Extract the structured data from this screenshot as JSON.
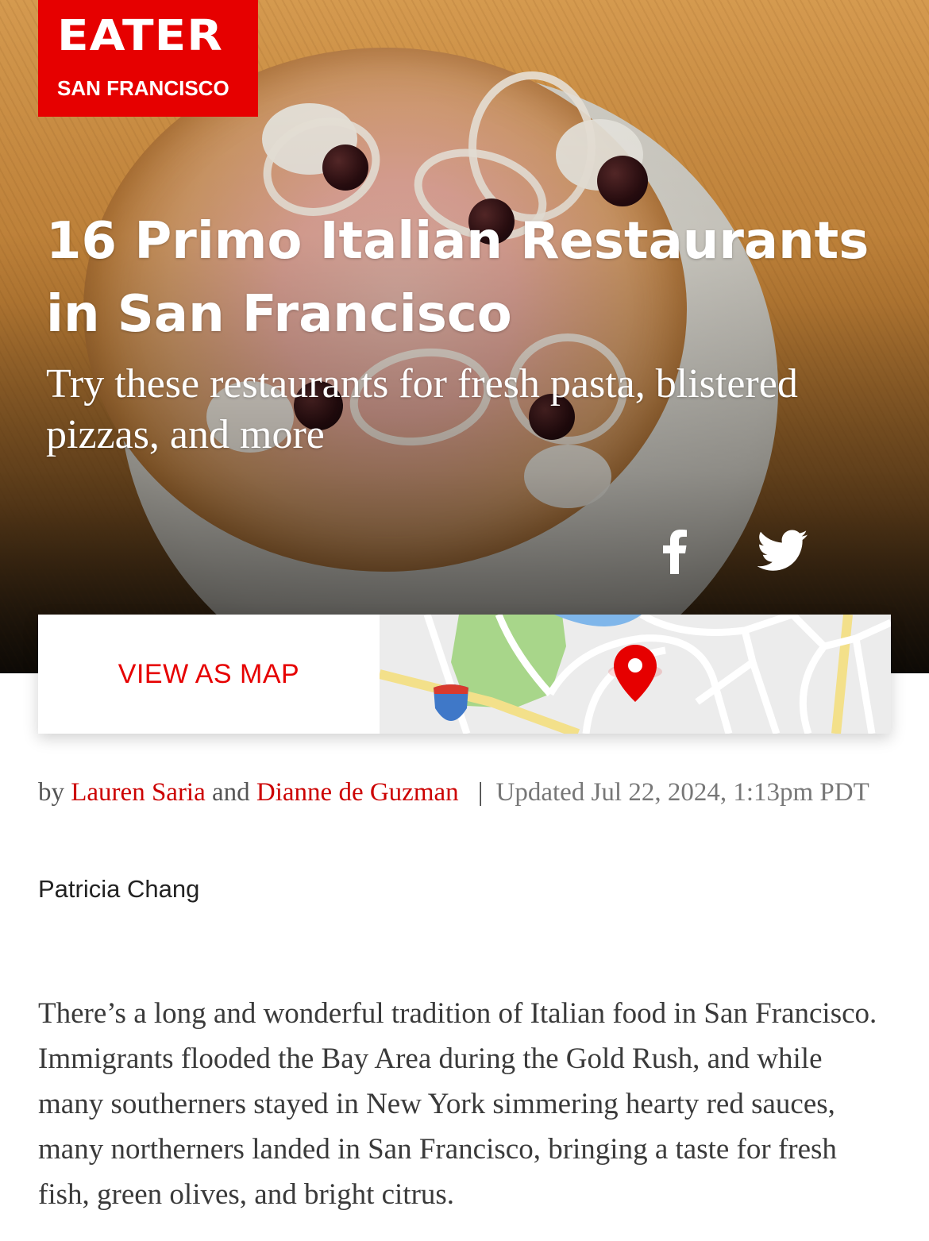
{
  "brand": {
    "name": "EATER",
    "city": "SAN FRANCISCO",
    "color": "#e60000"
  },
  "article": {
    "title": "16 Primo Italian Restaurants in San Francisco",
    "dek": "Try these restaurants for fresh pasta, blistered pizzas, and more",
    "byline": {
      "prefix": "by",
      "author1": "Lauren Saria",
      "conjunction": "and",
      "author2": "Dianne de Guzman",
      "separator": "|",
      "updated": "Updated Jul 22, 2024, 1:13pm PDT"
    },
    "photo_credit": "Patricia Chang",
    "intro": "There’s a long and wonderful tradition of Italian food in San Francisco. Immigrants flooded the Bay Area during the Gold Rush, and while many southerners stayed in New York simmering hearty red sauces, many northerners landed in San Francisco, bringing a taste for fresh fish, green olives, and bright citrus."
  },
  "share": {
    "facebook_icon": "facebook-icon",
    "twitter_icon": "twitter-icon"
  },
  "map_card": {
    "button_label": "VIEW AS MAP",
    "pin_icon": "map-pin-icon",
    "accent": "#e60000"
  }
}
